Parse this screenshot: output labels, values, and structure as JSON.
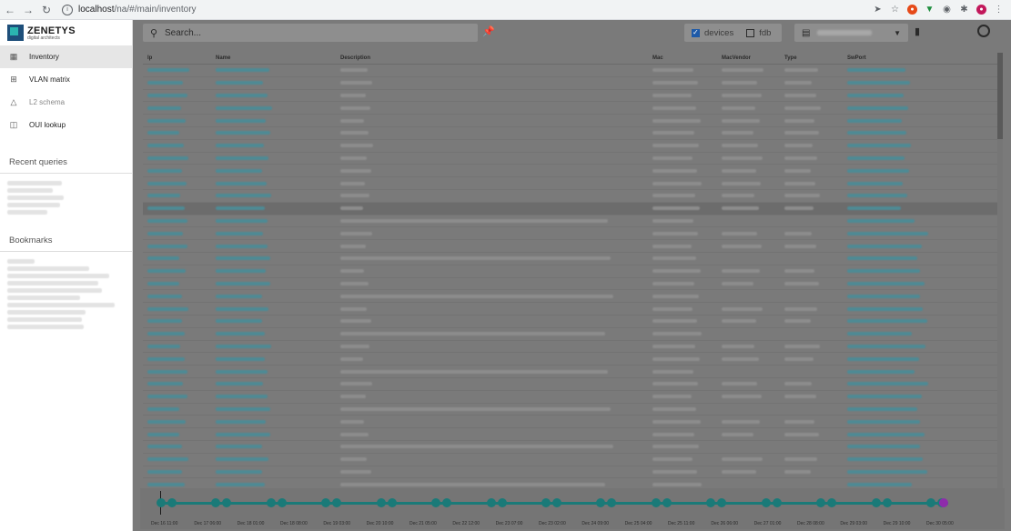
{
  "browser": {
    "url_host": "localhost",
    "url_path": "/na/#/main/inventory",
    "extension_icons": [
      "send-icon",
      "star-icon",
      "extension-red-icon",
      "extension-green-icon",
      "camera-icon",
      "puzzle-icon",
      "profile-icon",
      "menu-icon"
    ]
  },
  "brand": {
    "name": "ZENETYS",
    "tagline": "digital architects",
    "colors": {
      "dark": "#1e4f7a",
      "accent": "#2bb5b0"
    }
  },
  "nav": [
    {
      "label": "Inventory",
      "icon": "grid-icon",
      "active": true
    },
    {
      "label": "VLAN matrix",
      "icon": "table-icon",
      "active": false
    },
    {
      "label": "L2 schema",
      "icon": "network-icon",
      "active": false
    },
    {
      "label": "OUI lookup",
      "icon": "device-icon",
      "active": false
    }
  ],
  "recent_queries_title": "Recent queries",
  "bookmarks_title": "Bookmarks",
  "toolbar": {
    "search_placeholder": "Search...",
    "filter_devices": "devices",
    "filter_fdb": "fdb",
    "devices_checked": true,
    "fdb_checked": false
  },
  "table": {
    "columns": [
      "Ip",
      "Name",
      "Description",
      "Mac",
      "MacVendor",
      "Type",
      "SwPort"
    ]
  },
  "timeline": {
    "labels": [
      "Dec 16 11:00",
      "Dec 17 06:00",
      "Dec 18 01:00",
      "Dec 18 08:00",
      "Dec 19 03:00",
      "Dec 20 10:00",
      "Dec 21 05:00",
      "Dec 22 12:00",
      "Dec 23 07:00",
      "Dec 23 02:00",
      "Dec 24 09:00",
      "Dec 25 04:00",
      "Dec 25 11:00",
      "Dec 26 06:00",
      "Dec 27 01:00",
      "Dec 28 08:00",
      "Dec 29 03:00",
      "Dec 29 10:00",
      "Dec 30 05:00"
    ],
    "colors": {
      "point": "#1a7a78",
      "current": "#8e2cab"
    }
  }
}
